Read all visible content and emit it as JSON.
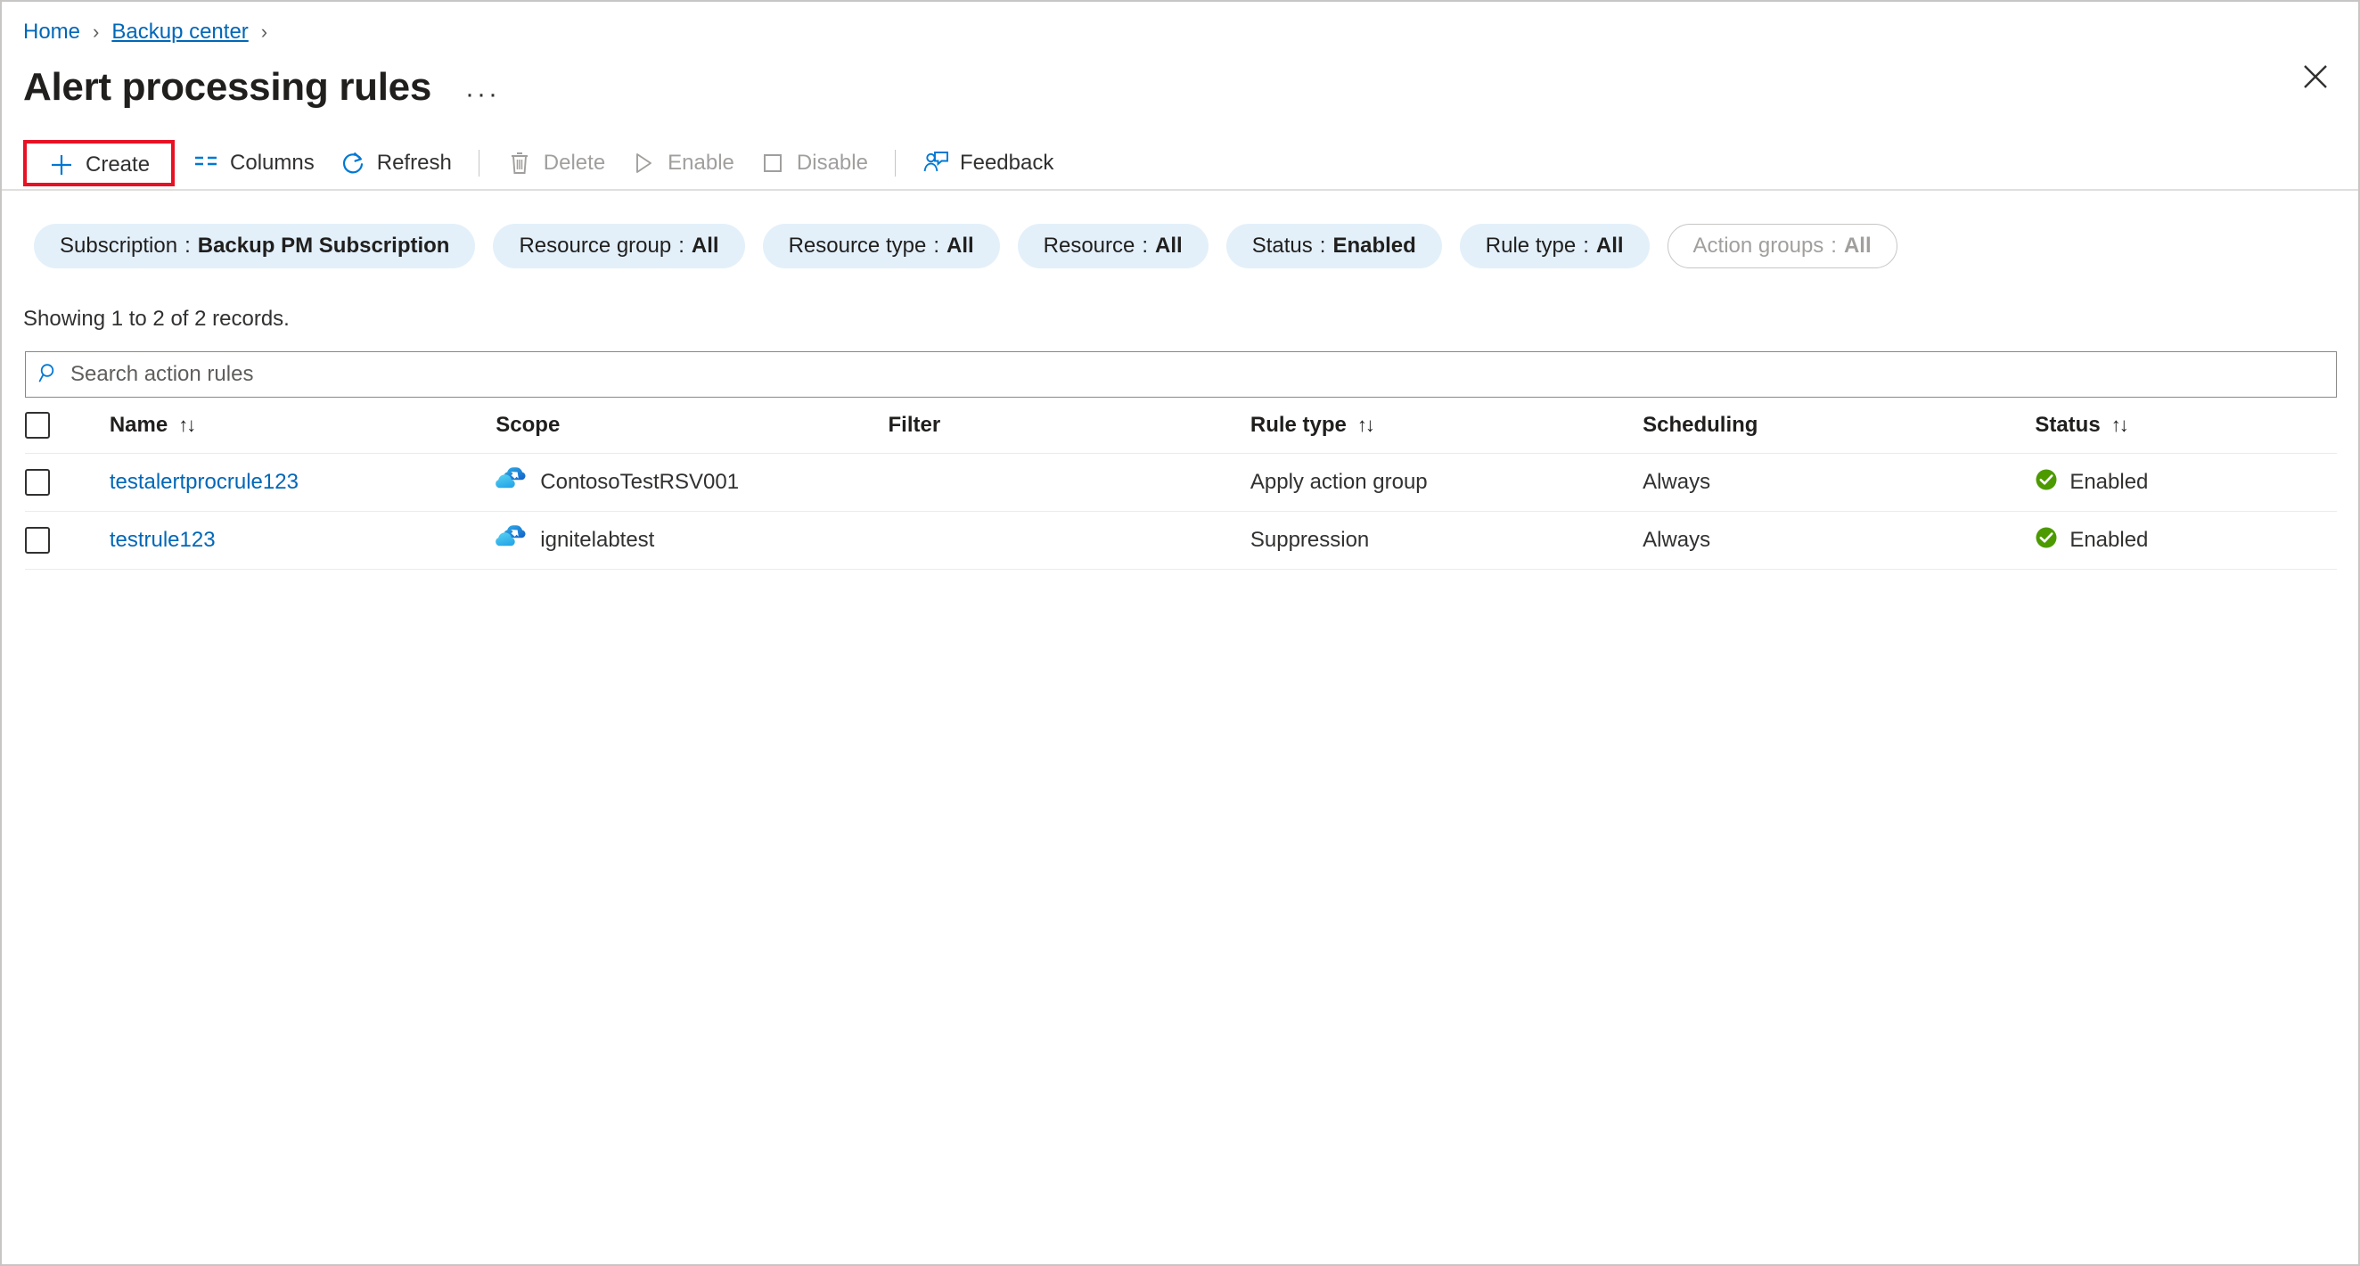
{
  "breadcrumb": {
    "items": [
      {
        "label": "Home",
        "underline": false
      },
      {
        "label": "Backup center",
        "underline": true
      }
    ],
    "separator": "›"
  },
  "header": {
    "title": "Alert processing rules",
    "ellipsis": "···",
    "close_icon": "close-icon"
  },
  "toolbar": {
    "create": {
      "label": "Create",
      "icon": "plus-icon",
      "disabled": false,
      "highlighted": true
    },
    "columns": {
      "label": "Columns",
      "icon": "columns-icon",
      "disabled": false
    },
    "refresh": {
      "label": "Refresh",
      "icon": "refresh-icon",
      "disabled": false
    },
    "delete": {
      "label": "Delete",
      "icon": "trash-icon",
      "disabled": true
    },
    "enable": {
      "label": "Enable",
      "icon": "play-icon",
      "disabled": true
    },
    "disable": {
      "label": "Disable",
      "icon": "stop-square-icon",
      "disabled": true
    },
    "feedback": {
      "label": "Feedback",
      "icon": "feedback-person-icon",
      "disabled": false
    }
  },
  "filters": [
    {
      "label": "Subscription",
      "sep": ":",
      "value": "Backup PM Subscription",
      "disabled": false
    },
    {
      "label": "Resource group",
      "sep": ":",
      "value": "All",
      "disabled": false
    },
    {
      "label": "Resource type",
      "sep": ":",
      "value": "All",
      "disabled": false
    },
    {
      "label": "Resource",
      "sep": ":",
      "value": "All",
      "disabled": false
    },
    {
      "label": "Status",
      "sep": ":",
      "value": "Enabled",
      "disabled": false
    },
    {
      "label": "Rule type",
      "sep": ":",
      "value": "All",
      "disabled": false
    },
    {
      "label": "Action groups",
      "sep": ":",
      "value": "All",
      "disabled": true
    }
  ],
  "results": {
    "showing_text": "Showing 1 to 2 of 2 records."
  },
  "search": {
    "placeholder": "Search action rules",
    "value": "",
    "icon": "search-icon"
  },
  "table": {
    "columns": [
      {
        "key": "name",
        "label": "Name",
        "sortable": true
      },
      {
        "key": "scope",
        "label": "Scope",
        "sortable": false
      },
      {
        "key": "filter",
        "label": "Filter",
        "sortable": false
      },
      {
        "key": "rule_type",
        "label": "Rule type",
        "sortable": true
      },
      {
        "key": "scheduling",
        "label": "Scheduling",
        "sortable": false
      },
      {
        "key": "status",
        "label": "Status",
        "sortable": true
      }
    ],
    "sort_glyph": "↑↓",
    "rows": [
      {
        "name": "testalertprocrule123",
        "scope": "ContosoTestRSV001",
        "scope_icon": "recovery-services-vault-icon",
        "filter": "",
        "rule_type": "Apply action group",
        "scheduling": "Always",
        "status": "Enabled",
        "status_icon": "check-circle-icon"
      },
      {
        "name": "testrule123",
        "scope": "ignitelabtest",
        "scope_icon": "recovery-services-vault-icon",
        "filter": "",
        "rule_type": "Suppression",
        "scheduling": "Always",
        "status": "Enabled",
        "status_icon": "check-circle-icon"
      }
    ]
  },
  "colors": {
    "link": "#0067b8",
    "accent_blue": "#0078d4",
    "pill_bg": "#e3f0fa",
    "highlight_red": "#e81123",
    "status_green": "#4c9a00",
    "disabled_text": "#a19f9d"
  }
}
